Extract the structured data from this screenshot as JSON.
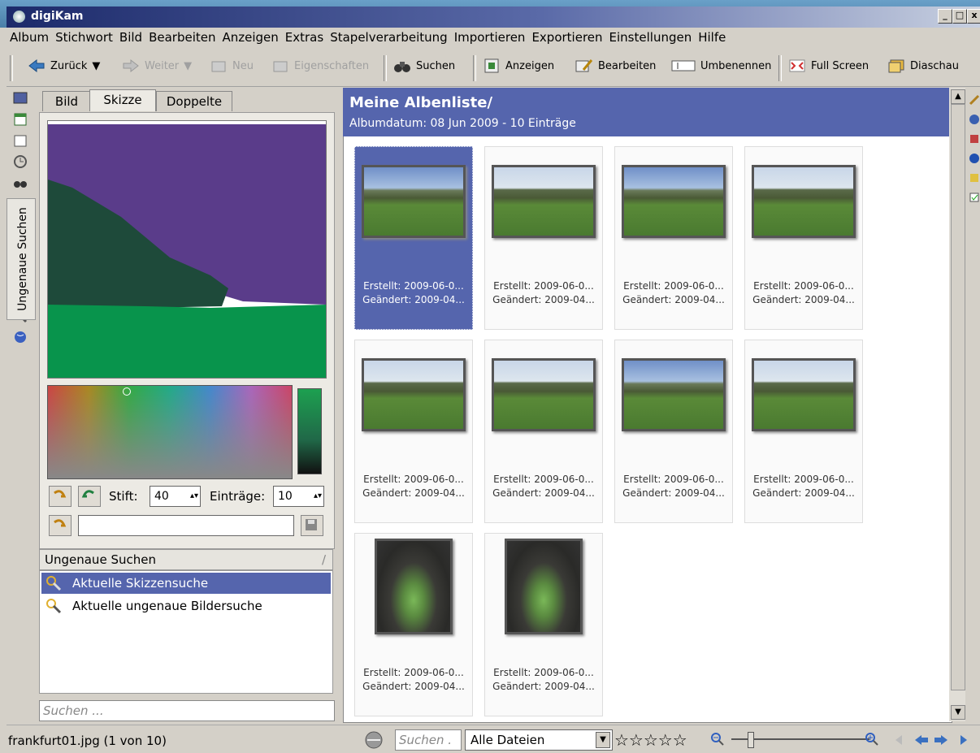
{
  "window": {
    "title": "digiKam"
  },
  "menu": [
    "Album",
    "Stichwort",
    "Bild",
    "Bearbeiten",
    "Anzeigen",
    "Extras",
    "Stapelverarbeitung",
    "Importieren",
    "Exportieren",
    "Einstellungen",
    "Hilfe"
  ],
  "toolbar": {
    "back": "Zurück",
    "forward": "Weiter",
    "new": "Neu",
    "properties": "Eigenschaften",
    "search": "Suchen",
    "view": "Anzeigen",
    "edit": "Bearbeiten",
    "rename": "Umbenennen",
    "fullscreen": "Full Screen",
    "slideshow": "Diaschau"
  },
  "sidebar": {
    "vertical_tab": "Ungenaue Suchen"
  },
  "left_panel": {
    "tabs": [
      "Bild",
      "Skizze",
      "Doppelte"
    ],
    "pen_label": "Stift:",
    "pen_value": "40",
    "entries_label": "Einträge:",
    "entries_value": "10",
    "fuzzy_header": "Ungenaue Suchen",
    "fuzzy_items": [
      "Aktuelle Skizzensuche",
      "Aktuelle ungenaue Bildersuche"
    ],
    "search_placeholder": "Suchen ..."
  },
  "album": {
    "title": "Meine Albenliste/",
    "subtitle": "Albumdatum: 08 Jun 2009 - 10 Einträge",
    "items": [
      {
        "created": "Erstellt: 2009-06-0...",
        "modified": "Geändert: 2009-04...",
        "kind": "hazy-landscape",
        "selected": true
      },
      {
        "created": "Erstellt: 2009-06-0...",
        "modified": "Geändert: 2009-04...",
        "kind": "landscape",
        "selected": false
      },
      {
        "created": "Erstellt: 2009-06-0...",
        "modified": "Geändert: 2009-04...",
        "kind": "landscape-blue",
        "selected": false
      },
      {
        "created": "Erstellt: 2009-06-0...",
        "modified": "Geändert: 2009-04...",
        "kind": "landscape",
        "selected": false
      },
      {
        "created": "Erstellt: 2009-06-0...",
        "modified": "Geändert: 2009-04...",
        "kind": "landscape",
        "selected": false
      },
      {
        "created": "Erstellt: 2009-06-0...",
        "modified": "Geändert: 2009-04...",
        "kind": "landscape",
        "selected": false
      },
      {
        "created": "Erstellt: 2009-06-0...",
        "modified": "Geändert: 2009-04...",
        "kind": "landscape-blue",
        "selected": false
      },
      {
        "created": "Erstellt: 2009-06-0...",
        "modified": "Geändert: 2009-04...",
        "kind": "landscape",
        "selected": false
      },
      {
        "created": "Erstellt: 2009-06-0...",
        "modified": "Geändert: 2009-04...",
        "kind": "plant",
        "selected": false
      },
      {
        "created": "Erstellt: 2009-06-0...",
        "modified": "Geändert: 2009-04...",
        "kind": "plant",
        "selected": false
      }
    ]
  },
  "status": {
    "file": "frankfurt01.jpg (1 von 10)",
    "search_placeholder": "Suchen .",
    "filter": "Alle Dateien",
    "rating": "☆☆☆☆☆"
  },
  "colors": {
    "accent": "#5565ad",
    "sketch_purple": "#5a3c8a",
    "sketch_darkgreen": "#1e4a3a",
    "sketch_green": "#08944c"
  }
}
